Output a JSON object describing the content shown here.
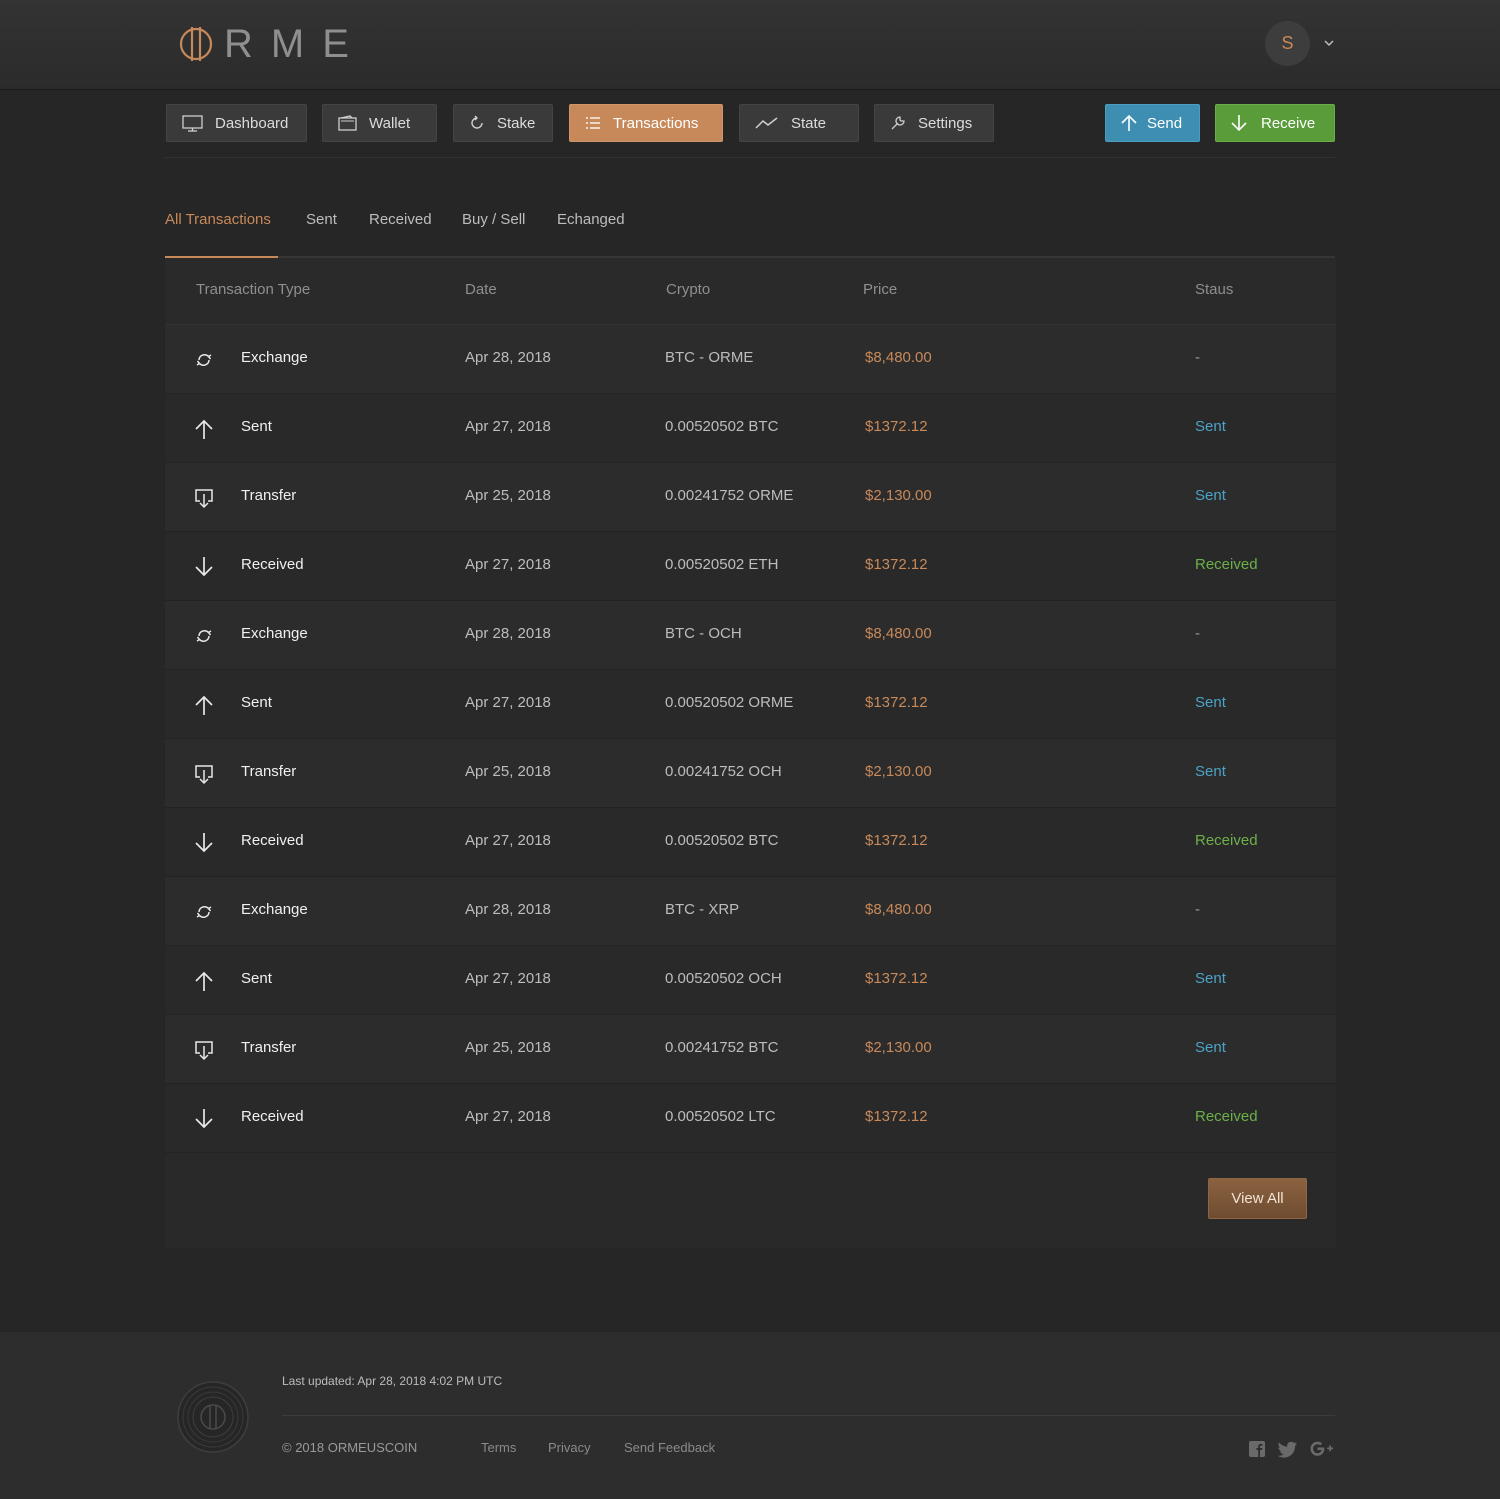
{
  "brand": {
    "logo_text": "RME",
    "accent": "#c8895a"
  },
  "user": {
    "avatar_initial": "S"
  },
  "nav": {
    "dashboard": "Dashboard",
    "wallet": "Wallet",
    "stake": "Stake",
    "transactions": "Transactions",
    "state": "State",
    "settings": "Settings",
    "send": "Send",
    "receive": "Receive",
    "active": "transactions"
  },
  "tabs": [
    "All Transactions",
    "Sent",
    "Received",
    "Buy / Sell",
    "Echanged"
  ],
  "table": {
    "headers": [
      "Transaction Type",
      "Date",
      "Crypto",
      "Price",
      "Staus"
    ],
    "rows": [
      {
        "icon": "exchange-icon",
        "type": "Exchange",
        "date": "Apr 28, 2018",
        "crypto": "BTC - ORME",
        "price": "$8,480.00",
        "status": "-",
        "status_kind": "none"
      },
      {
        "icon": "arrow-up-icon",
        "type": "Sent",
        "date": "Apr 27, 2018",
        "crypto": "0.00520502 BTC",
        "price": "$1372.12",
        "status": "Sent",
        "status_kind": "sent"
      },
      {
        "icon": "transfer-icon",
        "type": "Transfer",
        "date": "Apr 25, 2018",
        "crypto": "0.00241752 ORME",
        "price": "$2,130.00",
        "status": "Sent",
        "status_kind": "sent"
      },
      {
        "icon": "arrow-down-icon",
        "type": "Received",
        "date": "Apr 27, 2018",
        "crypto": "0.00520502 ETH",
        "price": "$1372.12",
        "status": "Received",
        "status_kind": "received"
      },
      {
        "icon": "exchange-icon",
        "type": "Exchange",
        "date": "Apr 28, 2018",
        "crypto": "BTC - OCH",
        "price": "$8,480.00",
        "status": "-",
        "status_kind": "none"
      },
      {
        "icon": "arrow-up-icon",
        "type": "Sent",
        "date": "Apr 27, 2018",
        "crypto": "0.00520502 ORME",
        "price": "$1372.12",
        "status": "Sent",
        "status_kind": "sent"
      },
      {
        "icon": "transfer-icon",
        "type": "Transfer",
        "date": "Apr 25, 2018",
        "crypto": "0.00241752 OCH",
        "price": "$2,130.00",
        "status": "Sent",
        "status_kind": "sent"
      },
      {
        "icon": "arrow-down-icon",
        "type": "Received",
        "date": "Apr 27, 2018",
        "crypto": "0.00520502 BTC",
        "price": "$1372.12",
        "status": "Received",
        "status_kind": "received"
      },
      {
        "icon": "exchange-icon",
        "type": "Exchange",
        "date": "Apr 28, 2018",
        "crypto": "BTC - XRP",
        "price": "$8,480.00",
        "status": "-",
        "status_kind": "none"
      },
      {
        "icon": "arrow-up-icon",
        "type": "Sent",
        "date": "Apr 27, 2018",
        "crypto": "0.00520502 OCH",
        "price": "$1372.12",
        "status": "Sent",
        "status_kind": "sent"
      },
      {
        "icon": "transfer-icon",
        "type": "Transfer",
        "date": "Apr 25, 2018",
        "crypto": "0.00241752 BTC",
        "price": "$2,130.00",
        "status": "Sent",
        "status_kind": "sent"
      },
      {
        "icon": "arrow-down-icon",
        "type": "Received",
        "date": "Apr 27, 2018",
        "crypto": "0.00520502 LTC",
        "price": "$1372.12",
        "status": "Received",
        "status_kind": "received"
      }
    ],
    "view_all": "View All"
  },
  "footer": {
    "last_updated": "Last updated: Apr 28, 2018 4:02 PM UTC",
    "copyright": "© 2018 ORMEUSCOIN",
    "links": [
      "Terms",
      "Privacy",
      "Send Feedback"
    ],
    "social": [
      "facebook-icon",
      "twitter-icon",
      "google-plus-icon"
    ]
  },
  "colors": {
    "sent": "#4ba3c7",
    "received": "#6cb04a",
    "send_button": "#3d8eb0",
    "receive_button": "#5a9c3a",
    "active_tab": "#c8895a"
  }
}
